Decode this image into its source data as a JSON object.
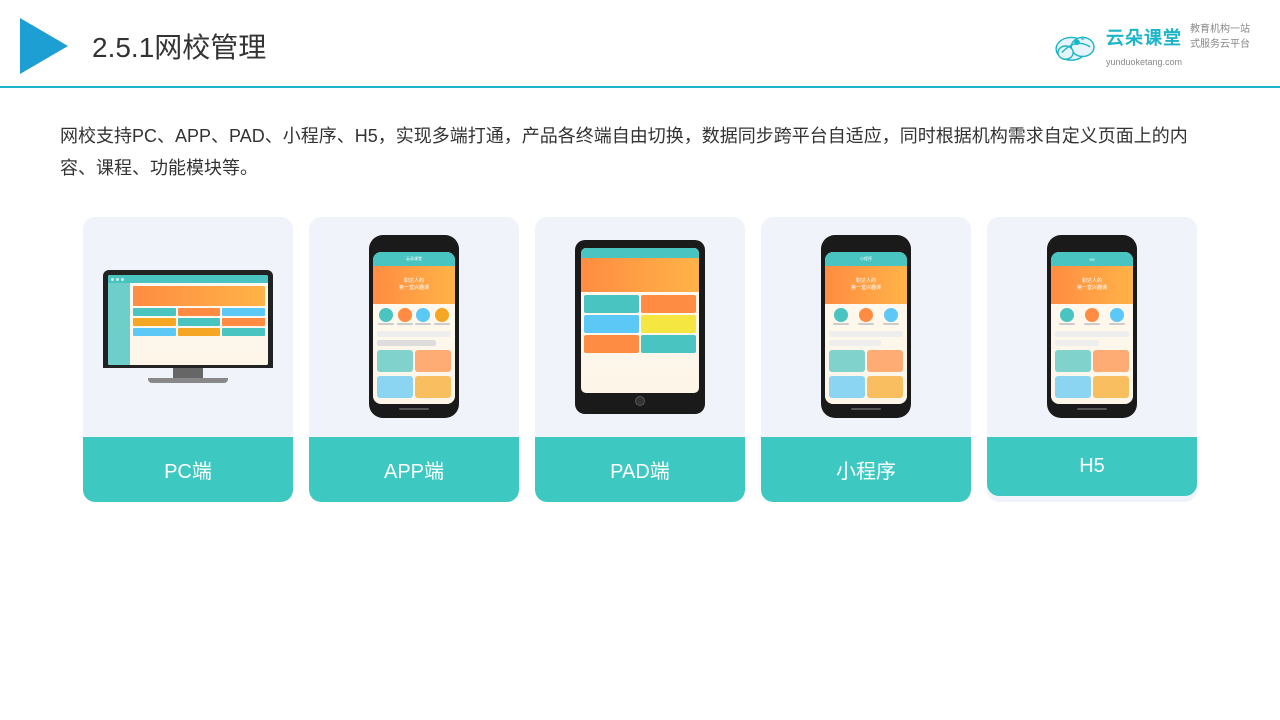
{
  "header": {
    "title": "2.5.1网校管理",
    "title_num": "2.5.1",
    "title_text": "网校管理"
  },
  "brand": {
    "name": "云朵课堂",
    "url": "yunduoketang.com",
    "slogan": "教育机构一站\n式服务云平台"
  },
  "description": {
    "text": "网校支持PC、APP、PAD、小程序、H5，实现多端打通，产品各终端自由切换，数据同步跨平台自适应，同时根据机构需求自定义页面上的内容、课程、功能模块等。"
  },
  "cards": [
    {
      "id": "pc",
      "label": "PC端"
    },
    {
      "id": "app",
      "label": "APP端"
    },
    {
      "id": "pad",
      "label": "PAD端"
    },
    {
      "id": "miniprogram",
      "label": "小程序"
    },
    {
      "id": "h5",
      "label": "H5"
    }
  ],
  "colors": {
    "teal": "#3dc8c2",
    "header_line": "#1ab5c8",
    "accent_orange": "#ff8c42",
    "accent_blue": "#5bc8f5"
  }
}
